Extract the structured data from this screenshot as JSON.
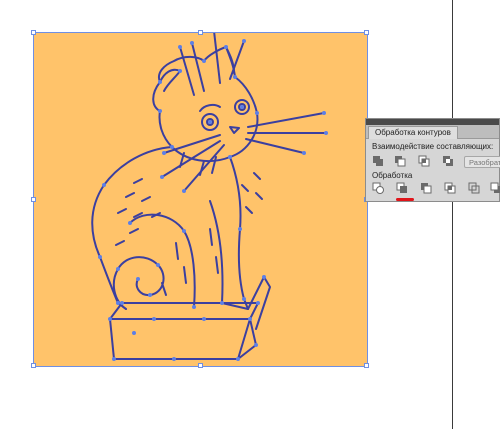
{
  "colors": {
    "artwork_bg": "#ffc36a",
    "cat_stroke": "#3b3fa0",
    "anchor": "#5d7fe6",
    "selection": "#6f8fe3",
    "panel_bg": "#d6d6d6",
    "highlight_mark": "#e0141a"
  },
  "pathfinder": {
    "tab_label": "Обработка контуров",
    "shape_modes_label": "Взаимодействие составляющих:",
    "expand_label": "Разобрать",
    "pathfinders_label": "Обработка",
    "shape_mode_icons": [
      "unite-icon",
      "minus-front-icon",
      "intersect-icon",
      "exclude-icon"
    ],
    "pathfinder_icons": [
      "divide-icon",
      "trim-icon",
      "merge-icon",
      "crop-icon",
      "outline-icon",
      "minus-back-icon"
    ],
    "highlighted_button": "trim-icon"
  }
}
